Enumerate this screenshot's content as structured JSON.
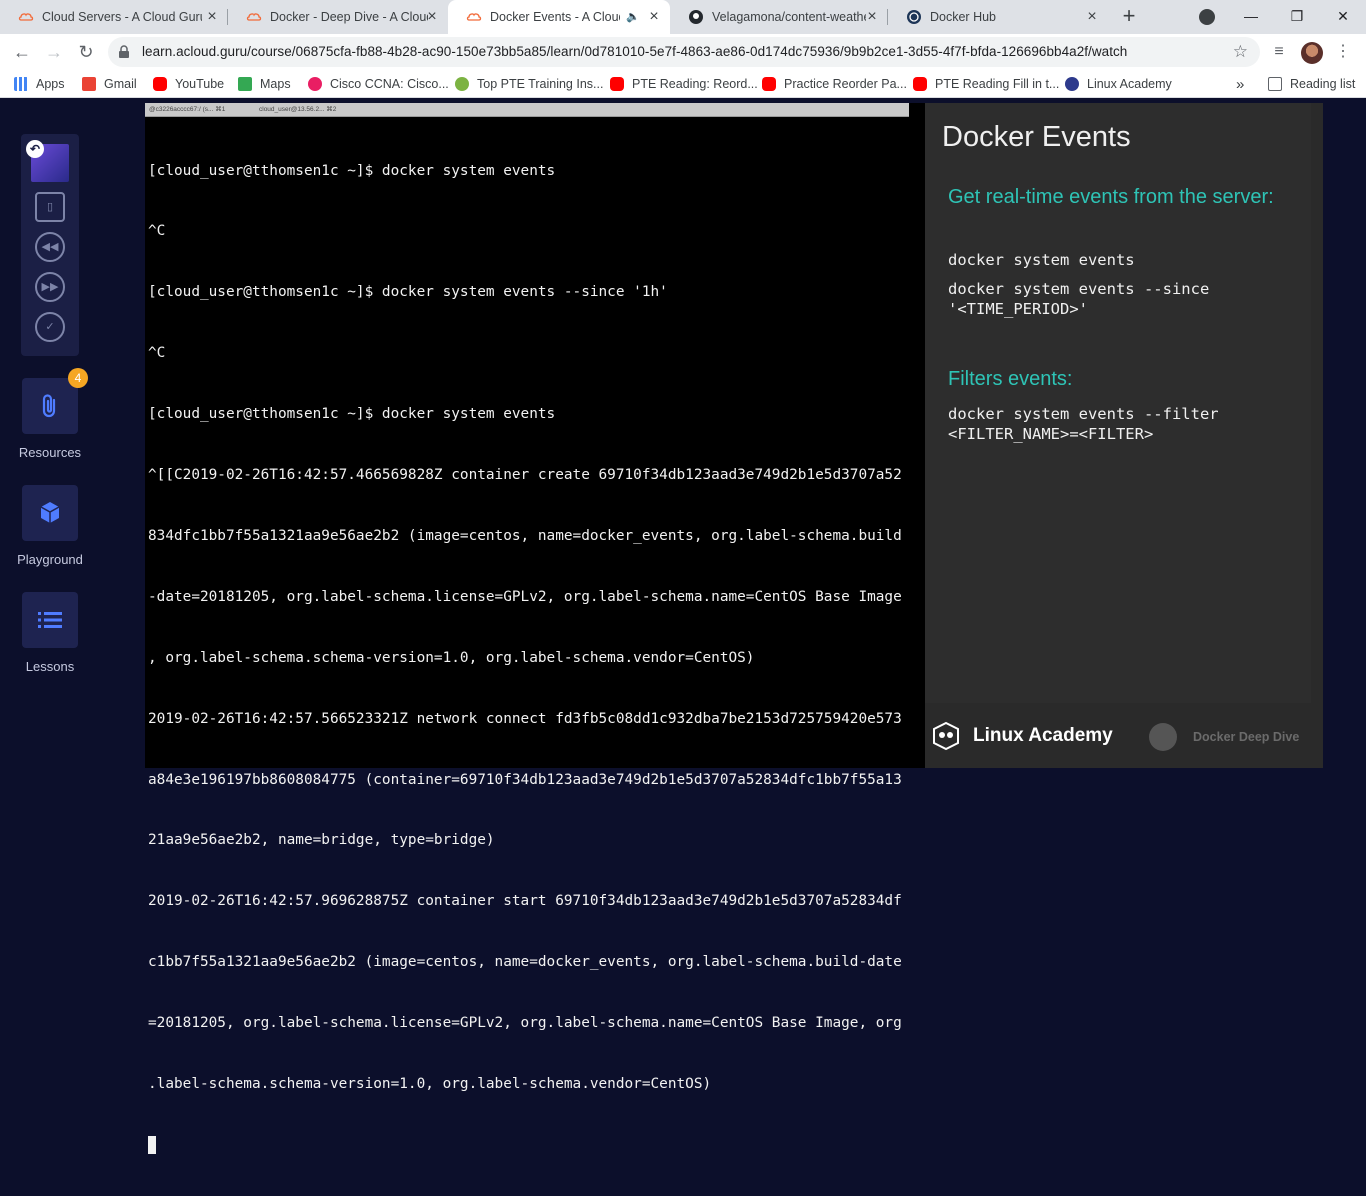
{
  "browser": {
    "tabs": [
      {
        "title": "Cloud Servers - A Cloud Guru",
        "active": false
      },
      {
        "title": "Docker - Deep Dive - A Cloud Guru",
        "active": false
      },
      {
        "title": "Docker Events - A Cloud Guru",
        "active": true
      },
      {
        "title": "Velagamona/content-weather",
        "active": false
      },
      {
        "title": "Docker Hub",
        "active": false
      }
    ],
    "new_tab_icon": "+",
    "window_controls": {
      "minimize": "—",
      "maximize": "❐",
      "close": "✕"
    },
    "url": "learn.acloud.guru/course/06875cfa-fb88-4b28-ac90-150e73bb5a85/learn/0d781010-5e7f-4863-ae86-0d174dc75936/9b9b2ce1-3d55-4f7f-bfda-126696bb4a2f/watch",
    "bookmarks": [
      {
        "label": "Apps",
        "color": "#4285f4"
      },
      {
        "label": "Gmail",
        "color": "#ea4335"
      },
      {
        "label": "YouTube",
        "color": "#ff0000"
      },
      {
        "label": "Maps",
        "color": "#34a853"
      },
      {
        "label": "Cisco CCNA: Cisco...",
        "color": "#e91e63"
      },
      {
        "label": "Top PTE Training Ins...",
        "color": "#7cb342"
      },
      {
        "label": "PTE Reading: Reord...",
        "color": "#ff0000"
      },
      {
        "label": "Practice Reorder Pa...",
        "color": "#ff0000"
      },
      {
        "label": "PTE Reading Fill in t...",
        "color": "#ff0000"
      },
      {
        "label": "Linux Academy",
        "color": "#2d3a8c"
      }
    ],
    "more_bookmarks": "»",
    "reading_list": "Reading list"
  },
  "sidebar": {
    "resources_label": "Resources",
    "resources_badge": "4",
    "playground_label": "Playground",
    "lessons_label": "Lessons"
  },
  "terminal": {
    "tabs": [
      "@c3226acccc67:/ (s... ⌘1",
      "cloud_user@13.56.2... ⌘2"
    ],
    "lines": [
      "[cloud_user@tthomsen1c ~]$ docker system events",
      "^C",
      "[cloud_user@tthomsen1c ~]$ docker system events --since '1h'",
      "^C",
      "[cloud_user@tthomsen1c ~]$ docker system events",
      "^[[C2019-02-26T16:42:57.466569828Z container create 69710f34db123aad3e749d2b1e5d3707a52",
      "834dfc1bb7f55a1321aa9e56ae2b2 (image=centos, name=docker_events, org.label-schema.build",
      "-date=20181205, org.label-schema.license=GPLv2, org.label-schema.name=CentOS Base Image",
      ", org.label-schema.schema-version=1.0, org.label-schema.vendor=CentOS)",
      "2019-02-26T16:42:57.566523321Z network connect fd3fb5c08dd1c932dba7be2153d725759420e573",
      "a84e3e196197bb8608084775 (container=69710f34db123aad3e749d2b1e5d3707a52834dfc1bb7f55a13",
      "21aa9e56ae2b2, name=bridge, type=bridge)",
      "2019-02-26T16:42:57.969628875Z container start 69710f34db123aad3e749d2b1e5d3707a52834df",
      "c1bb7f55a1321aa9e56ae2b2 (image=centos, name=docker_events, org.label-schema.build-date",
      "=20181205, org.label-schema.license=GPLv2, org.label-schema.name=CentOS Base Image, org",
      ".label-schema.schema-version=1.0, org.label-schema.vendor=CentOS)"
    ]
  },
  "slide": {
    "title": "Docker Events",
    "section1_heading": "Get real-time events from the server:",
    "cmd1": "docker system events",
    "cmd2": "docker system events --since\n'<TIME_PERIOD>'",
    "section2_heading": "Filters events:",
    "cmd3": "docker system events --filter\n<FILTER_NAME>=<FILTER>",
    "brand": "Linux Academy",
    "course": "Docker Deep Dive",
    "accent_color": "#2ec4b6"
  }
}
